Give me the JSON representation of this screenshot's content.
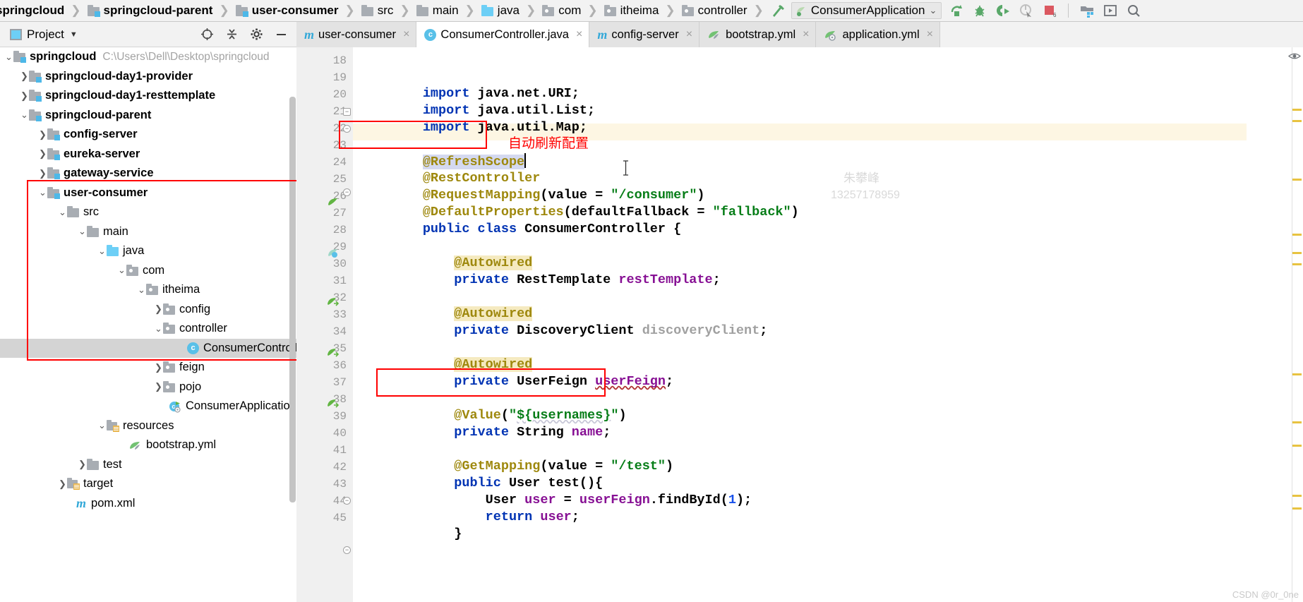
{
  "navbar": {
    "breadcrumbs": [
      {
        "label": "springcloud",
        "icon": "module-folder-icon",
        "bold": true,
        "truncated": true
      },
      {
        "label": "springcloud-parent",
        "icon": "module-folder-icon",
        "bold": true
      },
      {
        "label": "user-consumer",
        "icon": "module-folder-icon",
        "bold": true
      },
      {
        "label": "src",
        "icon": "folder-icon",
        "bold": false
      },
      {
        "label": "main",
        "icon": "folder-icon",
        "bold": false
      },
      {
        "label": "java",
        "icon": "source-folder-icon",
        "bold": false
      },
      {
        "label": "com",
        "icon": "package-folder-icon",
        "bold": false
      },
      {
        "label": "itheima",
        "icon": "package-folder-icon",
        "bold": false
      },
      {
        "label": "controller",
        "icon": "package-folder-icon",
        "bold": false
      }
    ],
    "build_icon": "build-hammer-icon",
    "run_config": {
      "label": "ConsumerApplication",
      "icon": "spring-boot-icon",
      "chevron": "chevron-down-icon"
    },
    "toolbar_buttons": [
      {
        "name": "run-button",
        "icon": "run-arrow-icon"
      },
      {
        "name": "debug-button",
        "icon": "debug-bug-icon"
      },
      {
        "name": "run-with-coverage-button",
        "icon": "run-coverage-icon"
      },
      {
        "name": "profile-button",
        "icon": "profiler-icon"
      },
      {
        "name": "stop-button",
        "icon": "stop-square-icon",
        "badge": "6"
      },
      {
        "name": "project-structure-button",
        "icon": "project-structure-icon"
      },
      {
        "name": "services-button",
        "icon": "services-play-icon"
      },
      {
        "name": "search-everywhere-button",
        "icon": "search-icon"
      }
    ]
  },
  "project_panel": {
    "title": "Project",
    "chevron": "chevron-down-icon",
    "window_icon": "project-window-icon",
    "actions": [
      {
        "name": "select-opened-file-button",
        "icon": "crosshair-target-icon"
      },
      {
        "name": "collapse-all-button",
        "icon": "collapse-all-icon"
      },
      {
        "name": "settings-button",
        "icon": "gear-icon"
      },
      {
        "name": "hide-button",
        "icon": "minimize-icon"
      }
    ]
  },
  "tabs": [
    {
      "label": "user-consumer",
      "icon": "maven-m-icon",
      "active": false,
      "close": "×"
    },
    {
      "label": "ConsumerController.java",
      "icon": "java-class-icon",
      "active": true,
      "close": "×"
    },
    {
      "label": "config-server",
      "icon": "maven-m-icon",
      "active": false,
      "close": "×"
    },
    {
      "label": "bootstrap.yml",
      "icon": "spring-yaml-icon",
      "active": false,
      "close": "×"
    },
    {
      "label": "application.yml",
      "icon": "spring-config-yaml-icon",
      "active": false,
      "close": "×"
    }
  ],
  "tree": [
    {
      "label": "springcloud",
      "path": "C:\\Users\\Dell\\Desktop\\springcloud",
      "indent": 0,
      "arrow": "v",
      "icon": "module-folder-icon",
      "bold": true,
      "selected": false
    },
    {
      "label": "springcloud-day1-provider",
      "path": "",
      "indent": 1,
      "arrow": ">",
      "icon": "module-folder-icon",
      "bold": true,
      "selected": false
    },
    {
      "label": "springcloud-day1-resttemplate",
      "path": "",
      "indent": 1,
      "arrow": ">",
      "icon": "module-folder-icon",
      "bold": true,
      "selected": false
    },
    {
      "label": "springcloud-parent",
      "path": "",
      "indent": 1,
      "arrow": "v",
      "icon": "module-folder-icon",
      "bold": true,
      "selected": false
    },
    {
      "label": "config-server",
      "path": "",
      "indent": 2,
      "arrow": ">",
      "icon": "module-folder-icon",
      "bold": true,
      "selected": false
    },
    {
      "label": "eureka-server",
      "path": "",
      "indent": 2,
      "arrow": ">",
      "icon": "module-folder-icon",
      "bold": true,
      "selected": false
    },
    {
      "label": "gateway-service",
      "path": "",
      "indent": 2,
      "arrow": ">",
      "icon": "module-folder-icon",
      "bold": true,
      "selected": false
    },
    {
      "label": "user-consumer",
      "path": "",
      "indent": 2,
      "arrow": "v",
      "icon": "module-folder-icon",
      "bold": true,
      "selected": false
    },
    {
      "label": "src",
      "path": "",
      "indent": 3,
      "arrow": "v",
      "icon": "folder-icon",
      "bold": false,
      "selected": false
    },
    {
      "label": "main",
      "path": "",
      "indent": 4,
      "arrow": "v",
      "icon": "folder-icon",
      "bold": false,
      "selected": false
    },
    {
      "label": "java",
      "path": "",
      "indent": 5,
      "arrow": "v",
      "icon": "source-folder-icon",
      "bold": false,
      "selected": false
    },
    {
      "label": "com",
      "path": "",
      "indent": 6,
      "arrow": "v",
      "icon": "package-folder-icon",
      "bold": false,
      "selected": false
    },
    {
      "label": "itheima",
      "path": "",
      "indent": 7,
      "arrow": "v",
      "icon": "package-folder-icon",
      "bold": false,
      "selected": false
    },
    {
      "label": "config",
      "path": "",
      "indent": 8,
      "arrow": ">",
      "icon": "package-folder-icon",
      "bold": false,
      "selected": false
    },
    {
      "label": "controller",
      "path": "",
      "indent": 8,
      "arrow": "v",
      "icon": "package-folder-icon",
      "bold": false,
      "selected": false
    },
    {
      "label": "ConsumerController",
      "path": "",
      "indent": 9,
      "arrow": "",
      "icon": "java-class-icon",
      "bold": false,
      "selected": true
    },
    {
      "label": "feign",
      "path": "",
      "indent": 8,
      "arrow": ">",
      "icon": "package-folder-icon",
      "bold": false,
      "selected": false
    },
    {
      "label": "pojo",
      "path": "",
      "indent": 8,
      "arrow": ">",
      "icon": "package-folder-icon",
      "bold": false,
      "selected": false
    },
    {
      "label": "ConsumerApplication",
      "path": "",
      "indent": 9,
      "arrow": "",
      "icon": "spring-boot-class-icon",
      "bold": false,
      "selected": false
    },
    {
      "label": "resources",
      "path": "",
      "indent": 5,
      "arrow": "v",
      "icon": "resources-folder-icon",
      "bold": false,
      "selected": false
    },
    {
      "label": "bootstrap.yml",
      "path": "",
      "indent": 6,
      "arrow": "",
      "icon": "spring-yaml-icon",
      "bold": false,
      "selected": false
    },
    {
      "label": "test",
      "path": "",
      "indent": 4,
      "arrow": ">",
      "icon": "folder-icon",
      "bold": false,
      "selected": false
    },
    {
      "label": "target",
      "path": "",
      "indent": 3,
      "arrow": ">",
      "icon": "target-folder-icon",
      "bold": false,
      "selected": false
    },
    {
      "label": "pom.xml",
      "path": "",
      "indent": 3,
      "arrow": "",
      "icon": "maven-m-icon",
      "bold": false,
      "selected": false
    }
  ],
  "editor": {
    "first_line_number": 18,
    "last_line_number": 45,
    "lines": [
      {
        "n": 18,
        "text": ""
      },
      {
        "n": 19,
        "text": "import java.net.URI;"
      },
      {
        "n": 20,
        "text": "import java.util.List;"
      },
      {
        "n": 21,
        "text": "import java.util.Map;"
      },
      {
        "n": 22,
        "text": ""
      },
      {
        "n": 23,
        "text": "@RefreshScope"
      },
      {
        "n": 24,
        "text": "@RestController"
      },
      {
        "n": 25,
        "text": "@RequestMapping(value = \"/consumer\")"
      },
      {
        "n": 26,
        "text": "@DefaultProperties(defaultFallback = \"fallback\")"
      },
      {
        "n": 27,
        "text": "public class ConsumerController {"
      },
      {
        "n": 28,
        "text": ""
      },
      {
        "n": 29,
        "text": "    @Autowired"
      },
      {
        "n": 30,
        "text": "    private RestTemplate restTemplate;"
      },
      {
        "n": 31,
        "text": ""
      },
      {
        "n": 32,
        "text": "    @Autowired"
      },
      {
        "n": 33,
        "text": "    private DiscoveryClient discoveryClient;"
      },
      {
        "n": 34,
        "text": ""
      },
      {
        "n": 35,
        "text": "    @Autowired"
      },
      {
        "n": 36,
        "text": "    private UserFeign userFeign;"
      },
      {
        "n": 37,
        "text": ""
      },
      {
        "n": 38,
        "text": "    @Value(\"${usernames}\")"
      },
      {
        "n": 39,
        "text": "    private String name;"
      },
      {
        "n": 40,
        "text": ""
      },
      {
        "n": 41,
        "text": "    @GetMapping(value = \"/test\")"
      },
      {
        "n": 42,
        "text": "    public User test(){"
      },
      {
        "n": 43,
        "text": "        User user = userFeign.findById(1);"
      },
      {
        "n": 44,
        "text": "        return user;"
      },
      {
        "n": 45,
        "text": "    }"
      }
    ],
    "annotation_note": "自动刷新配置",
    "annotation_color": "#ff0000",
    "highlight_color": "#fdf6e3"
  },
  "watermark": {
    "name": "朱攀峰",
    "phone": "13257178959"
  },
  "footer_watermark": "CSDN @0r_0ne"
}
